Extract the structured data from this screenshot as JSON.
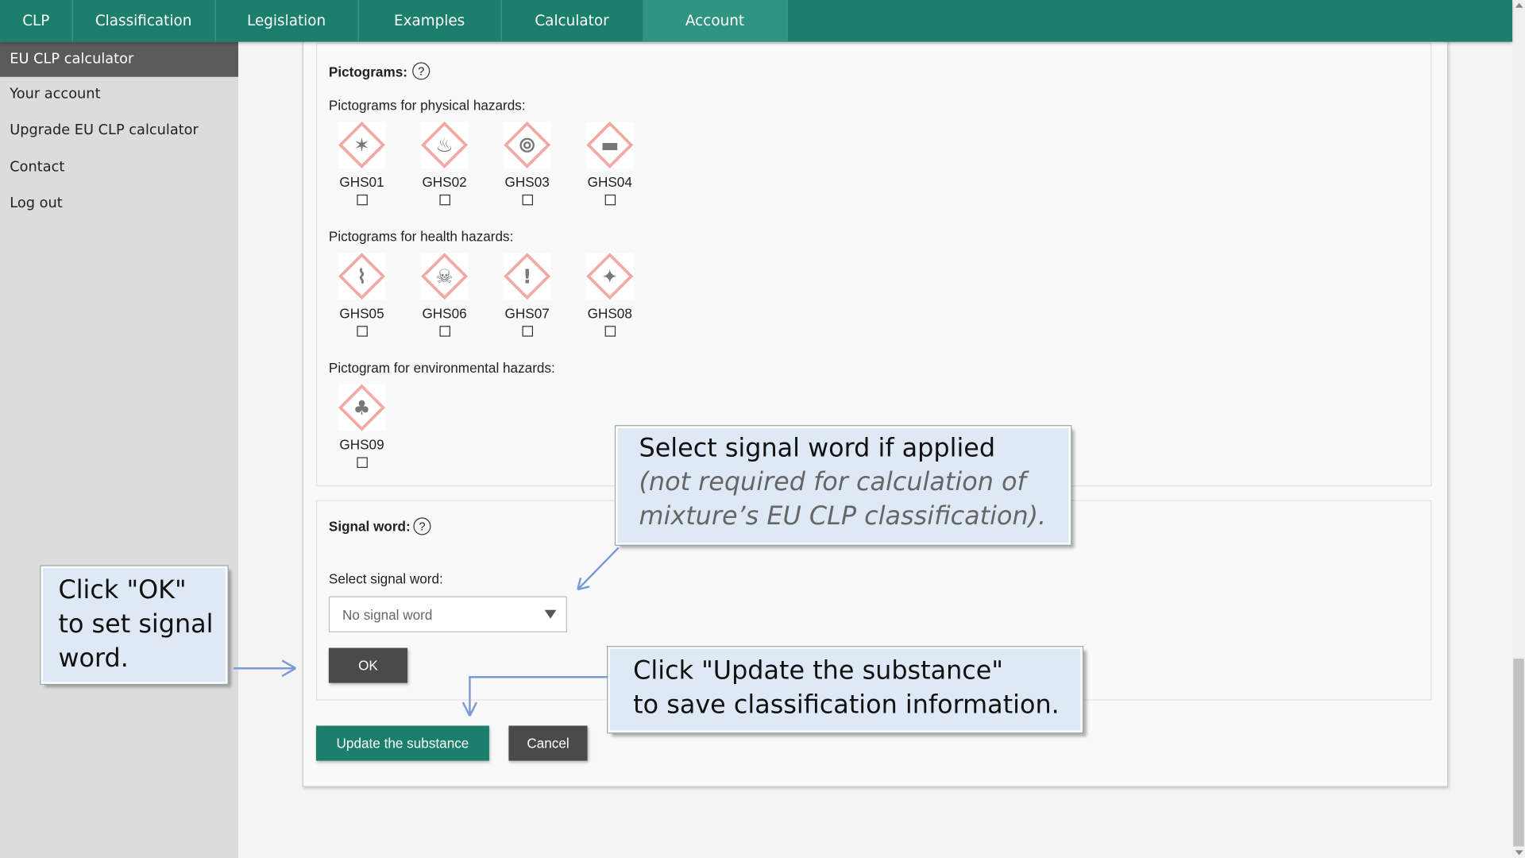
{
  "nav": {
    "tabs": [
      {
        "label": "CLP"
      },
      {
        "label": "Classification"
      },
      {
        "label": "Legislation"
      },
      {
        "label": "Examples"
      },
      {
        "label": "Calculator"
      },
      {
        "label": "Account",
        "active": true
      }
    ]
  },
  "sidebar": {
    "items": [
      {
        "label": "EU CLP calculator",
        "active": true
      },
      {
        "label": "Your account"
      },
      {
        "label": "Upgrade EU CLP calculator"
      },
      {
        "label": "Contact"
      },
      {
        "label": "Log out"
      }
    ]
  },
  "pictograms": {
    "title": "Pictograms:",
    "help": "?",
    "physical_label": "Pictograms for physical hazards:",
    "health_label": "Pictograms for health hazards:",
    "env_label": "Pictogram for environmental hazards:",
    "physical": [
      {
        "code": "GHS01",
        "icon": "exploding-bomb"
      },
      {
        "code": "GHS02",
        "icon": "flame"
      },
      {
        "code": "GHS03",
        "icon": "flame-over-circle"
      },
      {
        "code": "GHS04",
        "icon": "gas-cylinder"
      }
    ],
    "health": [
      {
        "code": "GHS05",
        "icon": "corrosion"
      },
      {
        "code": "GHS06",
        "icon": "skull-crossbones"
      },
      {
        "code": "GHS07",
        "icon": "exclamation-mark"
      },
      {
        "code": "GHS08",
        "icon": "health-hazard"
      }
    ],
    "environmental": [
      {
        "code": "GHS09",
        "icon": "environment"
      }
    ]
  },
  "signal": {
    "title": "Signal word:",
    "help": "?",
    "select_label": "Select signal word:",
    "selected": "No signal word",
    "ok": "OK"
  },
  "actions": {
    "update": "Update the substance",
    "cancel": "Cancel"
  },
  "callouts": {
    "signal_line1": "Select signal word if applied",
    "signal_line2": "(not required for calculation of",
    "signal_line3": "mixture’s EU CLP classification).",
    "ok_text": "Click \"OK\" to set signal word.",
    "update_line1": "Click \"Update the substance\"",
    "update_line2": "to save classification information."
  },
  "colors": {
    "nav": "#1b7f6c",
    "primary_button": "#1b7f6c",
    "dark_button": "#4a4a4a",
    "callout": "#dfe9f5",
    "arrow": "#7b9ad6",
    "picto_border": "#f2a8a4"
  }
}
